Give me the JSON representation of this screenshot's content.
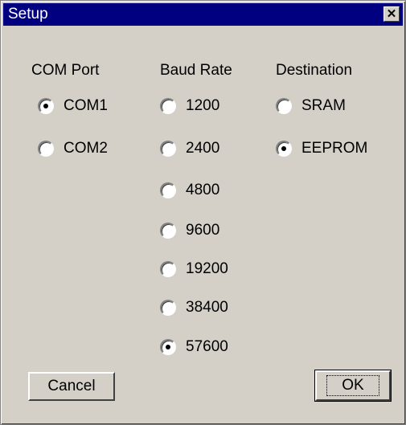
{
  "window": {
    "title": "Setup",
    "close_glyph": "✕"
  },
  "com_port": {
    "header": "COM Port",
    "options": [
      {
        "label": "COM1",
        "checked": true
      },
      {
        "label": "COM2",
        "checked": false
      }
    ]
  },
  "baud_rate": {
    "header": "Baud Rate",
    "options": [
      {
        "label": "1200",
        "checked": false
      },
      {
        "label": "2400",
        "checked": false
      },
      {
        "label": "4800",
        "checked": false
      },
      {
        "label": "9600",
        "checked": false
      },
      {
        "label": "19200",
        "checked": false
      },
      {
        "label": "38400",
        "checked": false
      },
      {
        "label": "57600",
        "checked": true
      }
    ]
  },
  "destination": {
    "header": "Destination",
    "options": [
      {
        "label": "SRAM",
        "checked": false
      },
      {
        "label": "EEPROM",
        "checked": true
      }
    ]
  },
  "buttons": {
    "cancel_label": "Cancel",
    "ok_label": "OK"
  },
  "colors": {
    "titlebar": "#000080",
    "face": "#d4d0c8"
  }
}
